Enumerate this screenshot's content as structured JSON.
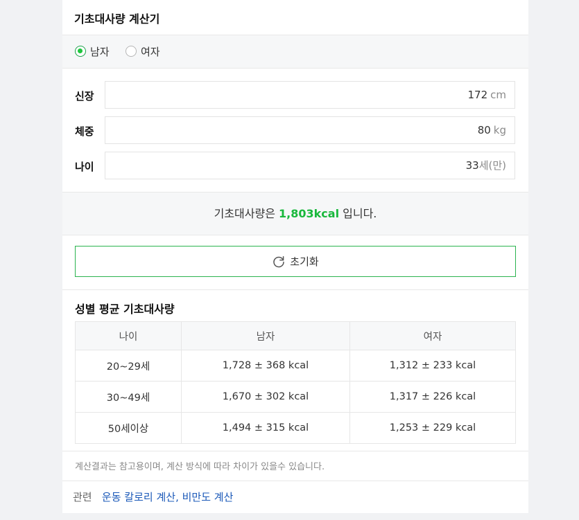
{
  "title": "기초대사량 계산기",
  "gender": {
    "options": [
      {
        "label": "남자",
        "selected": true
      },
      {
        "label": "여자",
        "selected": false
      }
    ]
  },
  "fields": {
    "height": {
      "label": "신장",
      "value": "172",
      "unit": "cm"
    },
    "weight": {
      "label": "체중",
      "value": "80",
      "unit": "kg"
    },
    "age": {
      "label": "나이",
      "value": "33",
      "unit": "세(만)"
    }
  },
  "result": {
    "prefix": "기초대사량은",
    "value": "1,803kcal",
    "suffix": "입니다."
  },
  "reset_label": "초기화",
  "avg_section": {
    "title": "성별 평균 기초대사량",
    "headers": [
      "나이",
      "남자",
      "여자"
    ],
    "rows": [
      [
        "20~29세",
        "1,728 ± 368 kcal",
        "1,312 ± 233 kcal"
      ],
      [
        "30~49세",
        "1,670 ± 302 kcal",
        "1,317 ± 226 kcal"
      ],
      [
        "50세이상",
        "1,494 ± 315 kcal",
        "1,253 ± 229 kcal"
      ]
    ]
  },
  "note": "계산결과는 참고용이며, 계산 방식에 따라 차이가 있을수 있습니다.",
  "related": {
    "label": "관련",
    "links": [
      "운동 칼로리 계산",
      "비만도 계산"
    ],
    "separator": ","
  },
  "colors": {
    "accent_green": "#19b83c",
    "link_blue": "#1a58b8",
    "border_green": "#2ab34e"
  },
  "icons": {
    "reset": "refresh-icon"
  }
}
